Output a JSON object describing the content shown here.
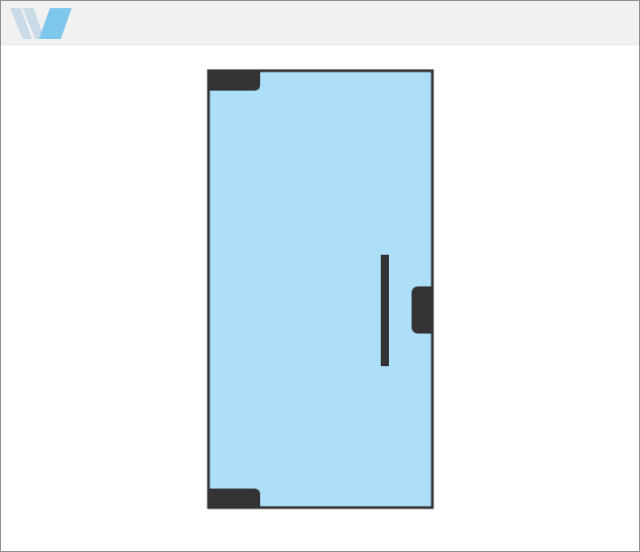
{
  "colors": {
    "glass_fill": "#ade0f8",
    "hardware": "#333336",
    "frame_border": "#8a8a8a",
    "header_bg": "#f1f1f1",
    "logo_light": "#c9dbe7",
    "logo_accent": "#7cc7eb"
  },
  "header": {
    "logo_icon": "brand-logo-icon"
  },
  "diagram": {
    "subject": "glass-door-elevation",
    "components": [
      "top-pivot-patch-fitting",
      "bottom-pivot-patch-fitting",
      "vertical-pull-handle",
      "side-lock-patch"
    ]
  }
}
